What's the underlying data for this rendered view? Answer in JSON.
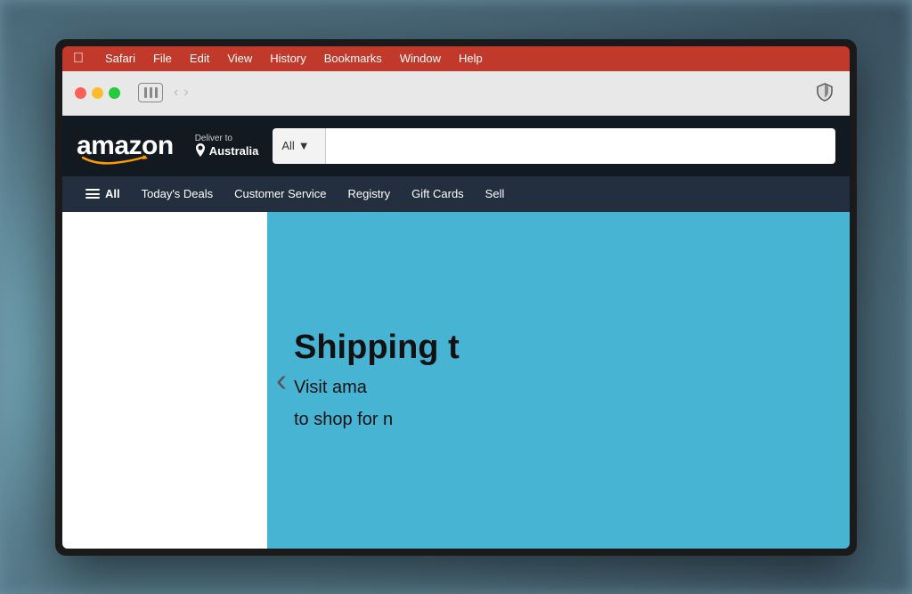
{
  "background": {
    "color": "#6a8fa0"
  },
  "menu_bar": {
    "items": [
      {
        "label": "Safari",
        "id": "safari"
      },
      {
        "label": "File",
        "id": "file"
      },
      {
        "label": "Edit",
        "id": "edit"
      },
      {
        "label": "View",
        "id": "view"
      },
      {
        "label": "History",
        "id": "history"
      },
      {
        "label": "Bookmarks",
        "id": "bookmarks"
      },
      {
        "label": "Window",
        "id": "window"
      },
      {
        "label": "Help",
        "id": "help"
      }
    ]
  },
  "amazon_header": {
    "logo": "amazon",
    "deliver_to_label": "Deliver to",
    "deliver_to_location": "Australia",
    "search_category": "All",
    "search_placeholder": ""
  },
  "amazon_nav": {
    "all_label": "All",
    "items": [
      {
        "label": "Today's Deals",
        "id": "todays-deals"
      },
      {
        "label": "Customer Service",
        "id": "customer-service"
      },
      {
        "label": "Registry",
        "id": "registry"
      },
      {
        "label": "Gift Cards",
        "id": "gift-cards"
      },
      {
        "label": "Sell",
        "id": "sell"
      }
    ]
  },
  "hero": {
    "title": "Shipping t",
    "subtitle_line1": "Visit ama",
    "subtitle_line2": "to shop for n"
  }
}
